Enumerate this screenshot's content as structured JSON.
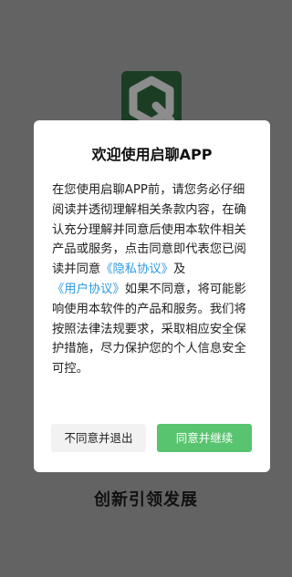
{
  "splash": {
    "logo_icon": "app-logo-icon",
    "tagline": "创新引领发展",
    "background_color": "#636363"
  },
  "dialog": {
    "title": "欢迎使用启聊APP",
    "body_before_privacy": "在您使用启聊APP前，请您务必仔细阅读并透彻理解相关条款内容，在确认充分理解并同意后使用本软件相关产品或服务，点击同意即代表您已阅读并同意",
    "privacy_link": "《隐私协议》",
    "conjunction": "及",
    "user_agreement_link": "《用户协议》",
    "body_after_links": "如果不同意，将可能影响使用本软件的产品和服务。我们将按照法律法规要求，采取相应安全保护措施，尽力保护您的个人信息安全可控。",
    "link_color": "#2f9be0",
    "decline_button": "不同意并退出",
    "accept_button": "同意并继续",
    "accept_color": "#58c46f"
  }
}
